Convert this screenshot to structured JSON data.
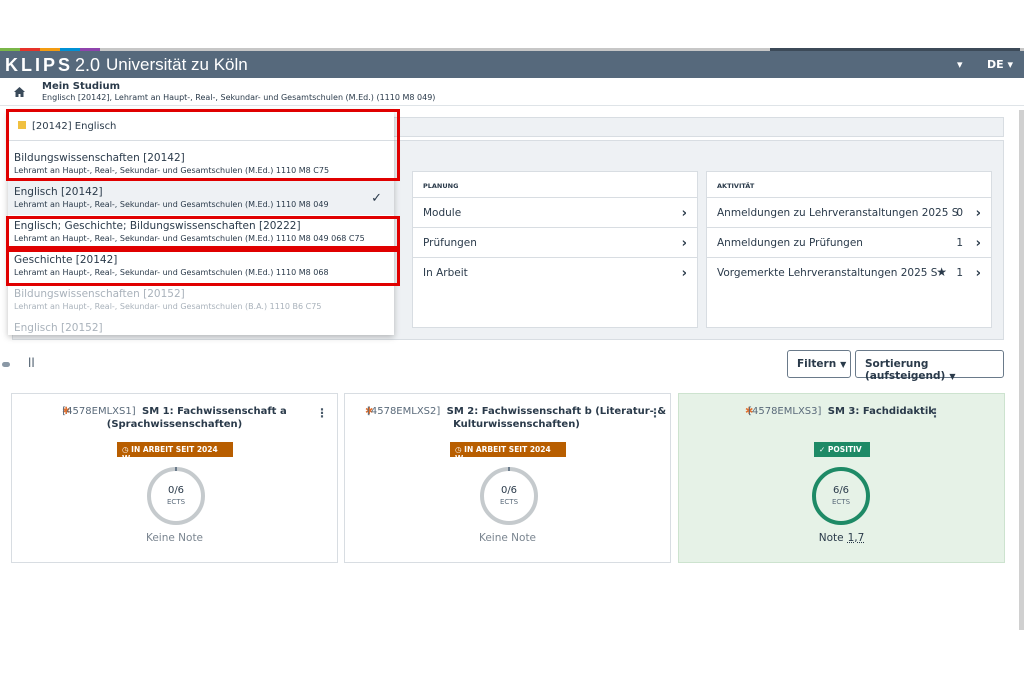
{
  "header": {
    "logo": "KLIPS",
    "logo_version": "2.0",
    "university": "Universität zu Köln",
    "user_menu_caret": "▾",
    "language": "DE ▾",
    "stripe_colors": [
      "#7ab648",
      "#e63329",
      "#f39c12",
      "#0091d5",
      "#8e44ad",
      "#c7c7c7"
    ]
  },
  "breadcrumb": {
    "home_icon": "home-icon",
    "title": "Mein Studium",
    "subtitle": "Englisch [20142], Lehramt an Haupt-, Real-, Sekundar- und Gesamtschulen (M.Ed.) (1110 M8 049)"
  },
  "dropdown": {
    "header": "[20142]  Englisch",
    "items": [
      {
        "title": "Bildungswissenschaften [20142]",
        "sub": "Lehramt an Haupt-, Real-, Sekundar- und Gesamtschulen (M.Ed.) 1110 M8 C75"
      },
      {
        "title": "Englisch [20142]",
        "sub": "Lehramt an Haupt-, Real-, Sekundar- und Gesamtschulen (M.Ed.) 1110 M8 049",
        "check": "✓"
      },
      {
        "title": "Englisch; Geschichte; Bildungswissenschaften [20222]",
        "sub": "Lehramt an Haupt-, Real-, Sekundar- und Gesamtschulen (M.Ed.) 1110 M8 049 068 C75"
      },
      {
        "title": "Geschichte [20142]",
        "sub": "Lehramt an Haupt-, Real-, Sekundar- und Gesamtschulen (M.Ed.) 1110 M8 068"
      },
      {
        "title": "Bildungswissenschaften [20152]",
        "sub": "Lehramt an Haupt-, Real-, Sekundar- und Gesamtschulen (B.A.) 1110 B6 C75"
      },
      {
        "title": "Englisch [20152]",
        "sub": ""
      }
    ]
  },
  "planung": {
    "heading": "PLANUNG",
    "rows": [
      {
        "label": "Module"
      },
      {
        "label": "Prüfungen"
      },
      {
        "label": "In Arbeit"
      }
    ]
  },
  "aktivitaet": {
    "heading": "AKTIVITÄT",
    "rows": [
      {
        "label": "Anmeldungen zu Lehrveranstaltungen 2025 S",
        "count": "0"
      },
      {
        "label": "Anmeldungen zu Prüfungen",
        "count": "1"
      },
      {
        "label": "Vorgemerkte Lehrveranstaltungen 2025 S",
        "count": "1",
        "star": "★"
      }
    ]
  },
  "toolbar": {
    "filter_label": "Filtern",
    "sort_label": "Sortierung (aufsteigend)",
    "side_fragment": "ll"
  },
  "cards": [
    {
      "code": "[4578EMLXS1]",
      "name_line1": "SM 1: Fachwissenschaft a",
      "name_line2": "(Sprachwissenschaften)",
      "badge": "IN ARBEIT SEIT 2024 W",
      "ects_value": "0/6",
      "ects_unit": "ECTS",
      "ects_fraction": 0,
      "grade": "Keine Note"
    },
    {
      "code": "[4578EMLXS2]",
      "name_line1": "SM 2: Fachwissenschaft b (Literatur- &",
      "name_line2": "Kulturwissenschaften)",
      "badge": "IN ARBEIT SEIT 2024 W",
      "ects_value": "0/6",
      "ects_unit": "ECTS",
      "ects_fraction": 0,
      "grade": "Keine Note"
    },
    {
      "code": "[4578EMLXS3]",
      "name_line1": "SM 3: Fachdidaktik",
      "name_line2": "",
      "badge": "POSITIV",
      "ects_value": "6/6",
      "ects_unit": "ECTS",
      "ects_fraction": 1,
      "grade_label": "Note",
      "grade_value": "1,7"
    }
  ]
}
